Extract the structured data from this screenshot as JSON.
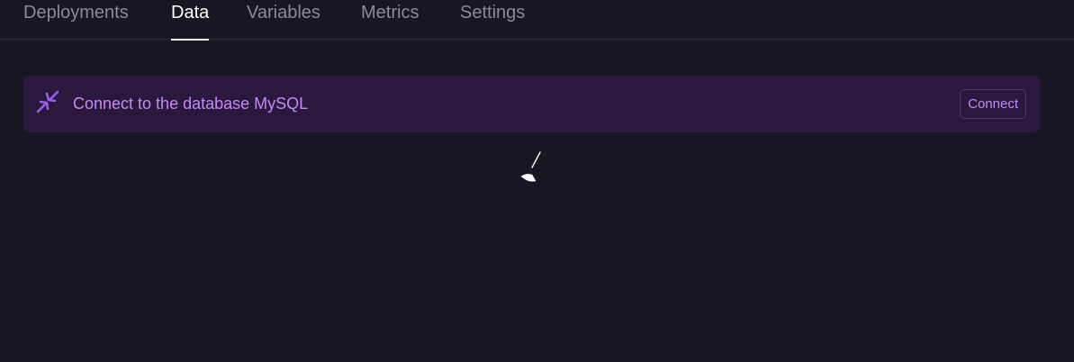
{
  "tabs": [
    {
      "label": "Deployments",
      "active": false
    },
    {
      "label": "Data",
      "active": true
    },
    {
      "label": "Variables",
      "active": false
    },
    {
      "label": "Metrics",
      "active": false
    },
    {
      "label": "Settings",
      "active": false
    }
  ],
  "banner": {
    "icon": "plug-connect-icon",
    "text": "Connect to the database MySQL",
    "button_label": "Connect"
  },
  "colors": {
    "background": "#181622",
    "banner_background": "#2b183d",
    "accent": "#c58af6",
    "tab_inactive": "#8c8a97",
    "tab_active": "#ffffff"
  },
  "loader": {
    "icon": "loading-spinner-icon"
  }
}
